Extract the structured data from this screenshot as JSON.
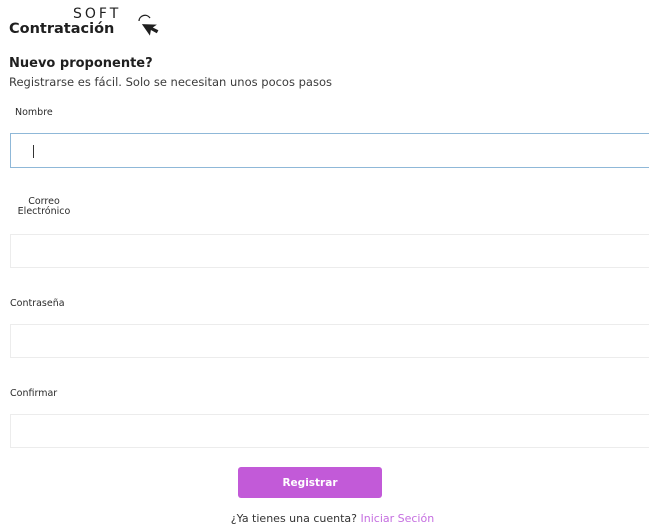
{
  "logo": {
    "soft": "SOFT",
    "main": "Contratación"
  },
  "register": {
    "title": "Nuevo proponente?",
    "subtitle": "Registrarse es fácil. Solo se necesitan unos pocos pasos"
  },
  "fields": {
    "nombre": {
      "label": "Nombre",
      "value": "",
      "placeholder": ""
    },
    "correo": {
      "label_line1": "Correo",
      "label_line2": "Electrónico",
      "value": "",
      "placeholder": ""
    },
    "contrasena": {
      "label": "Contraseña",
      "value": "",
      "placeholder": ""
    },
    "confirmar": {
      "label": "Confirmar",
      "value": "",
      "placeholder": ""
    }
  },
  "buttons": {
    "register_label": "Registrar"
  },
  "footer": {
    "prompt": "¿Ya tienes una cuenta?",
    "login_link": "Iniciar Seción"
  },
  "colors": {
    "accent": "#c25ad8",
    "link": "#c56ee0",
    "focus_border": "#8fb8d8"
  },
  "icons": {
    "logo_cursor": "cursor-arrow-icon"
  }
}
